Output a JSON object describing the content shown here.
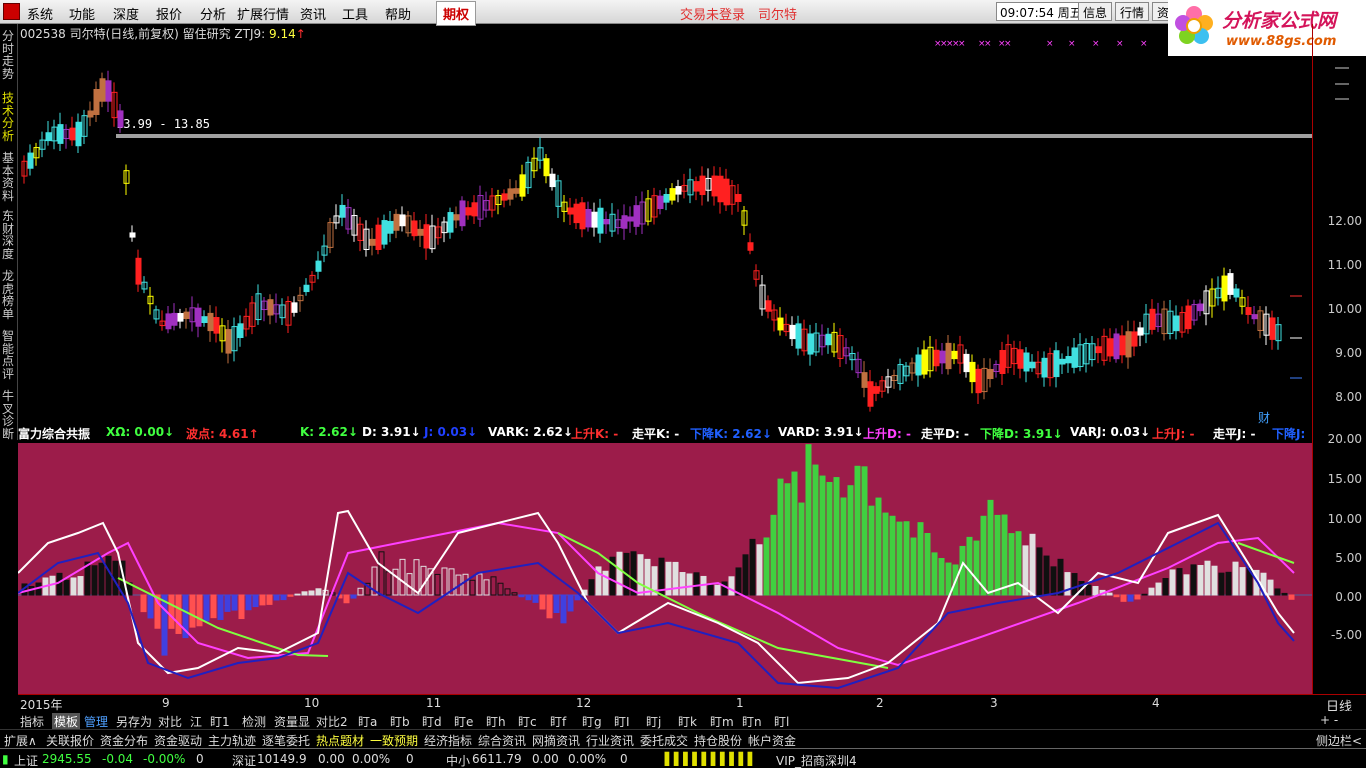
{
  "menu": {
    "items": [
      "系统",
      "功能",
      "深度",
      "报价",
      "分析",
      "扩展行情",
      "资讯",
      "工具",
      "帮助"
    ],
    "active": "期权",
    "message": "交易未登录　司尔特",
    "clock": "09:07:54",
    "weekday": "周五",
    "buttons": [
      "信息",
      "行情",
      "资"
    ]
  },
  "brand": {
    "name": "分析家公式网",
    "url": "www.88gs.com"
  },
  "sidebar": [
    "分时走势",
    "技术分析",
    "基本资料",
    "东财深度",
    "龙虎榜单",
    "智能点评",
    "牛叉诊断"
  ],
  "chart_title": {
    "stock": "002538 司尔特(日线,前复权) 留住研究 ZTJ9: ",
    "value": "9.14",
    "arrow": "↑"
  },
  "annotation": "13.99 - 13.85",
  "y_labels": [
    "12.00",
    "11.00",
    "10.00",
    "9.00",
    "8.00"
  ],
  "indicator_y_labels": [
    "20.00",
    "15.00",
    "10.00",
    "5.00",
    "0.00",
    "-5.00"
  ],
  "indicator_header": [
    {
      "text": "富力综合共振",
      "color": "#ffffff"
    },
    {
      "text": "XΩ: 0.00↓",
      "color": "#40ff40"
    },
    {
      "text": "波点: 4.61↑",
      "color": "#ff3030"
    },
    {
      "text": "K: 2.62↓",
      "color": "#40ff40"
    },
    {
      "text": "D: 3.91↓",
      "color": "#ffffff"
    },
    {
      "text": "J: 0.03↓",
      "color": "#2040ff"
    },
    {
      "text": "VARK: 2.62↓",
      "color": "#ffffff"
    },
    {
      "text": "上升K: -",
      "color": "#ff3030"
    },
    {
      "text": "走平K: -",
      "color": "#ffffff"
    },
    {
      "text": "下降K: 2.62↓",
      "color": "#2060ff"
    },
    {
      "text": "VARD: 3.91↓",
      "color": "#ffffff"
    },
    {
      "text": "上升D: -",
      "color": "#ff40ff"
    },
    {
      "text": "走平D: -",
      "color": "#ffffff"
    },
    {
      "text": "下降D: 3.91↓",
      "color": "#40ff40"
    },
    {
      "text": "VARJ: 0.03↓",
      "color": "#ffffff"
    },
    {
      "text": "上升J: -",
      "color": "#ff3030"
    },
    {
      "text": "走平J: -",
      "color": "#ffffff"
    },
    {
      "text": "下降J:",
      "color": "#2060ff"
    }
  ],
  "x_labels": [
    "2015年",
    "9",
    "10",
    "11",
    "12",
    "1",
    "2",
    "3",
    "4"
  ],
  "period_label": "日线",
  "tabs1": {
    "items": [
      "指标",
      "模板",
      "管理",
      "另存为",
      "对比",
      "江",
      "盯1",
      "检测",
      "资量显",
      "对比2",
      "盯a",
      "盯b",
      "盯d",
      "盯e",
      "盯h",
      "盯c",
      "盯f",
      "盯g",
      "盯I",
      "盯j",
      "盯k",
      "盯m",
      "盯n",
      "盯l"
    ],
    "selected": "模板",
    "selected2": "管理",
    "right": "+ -"
  },
  "tabs2": {
    "items": [
      "扩展∧",
      "关联报价",
      "资金分布",
      "资金驱动",
      "主力轨迹",
      "逐笔委托",
      "热点题材",
      "一致预期",
      "经济指标",
      "综合资讯",
      "网摘资讯",
      "行业资讯",
      "委托成交",
      "持仓股份",
      "帐户资金"
    ],
    "highlight": [
      "热点题材",
      "一致预期"
    ],
    "right": "侧边栏<"
  },
  "status": {
    "sh_label": "上证",
    "sh_value": "2945.55",
    "sh_change": "-0.04",
    "sh_pct": "-0.00%",
    "sh_vol": "0",
    "sz_label": "深证",
    "sz_value": "10149.9",
    "sz_change": "0.00",
    "sz_pct": "0.00%",
    "sz_vol": "0",
    "zx_label": "中小",
    "zx_value": "6611.79",
    "zx_change": "0.00",
    "zx_pct": "0.00%",
    "zx_vol": "0",
    "broker": "VIP_招商深圳4"
  },
  "colors": {
    "up": "#ff2020",
    "down": "#40e0e0",
    "panel": "#9c1c4a",
    "bullet": "#ff40ff"
  }
}
